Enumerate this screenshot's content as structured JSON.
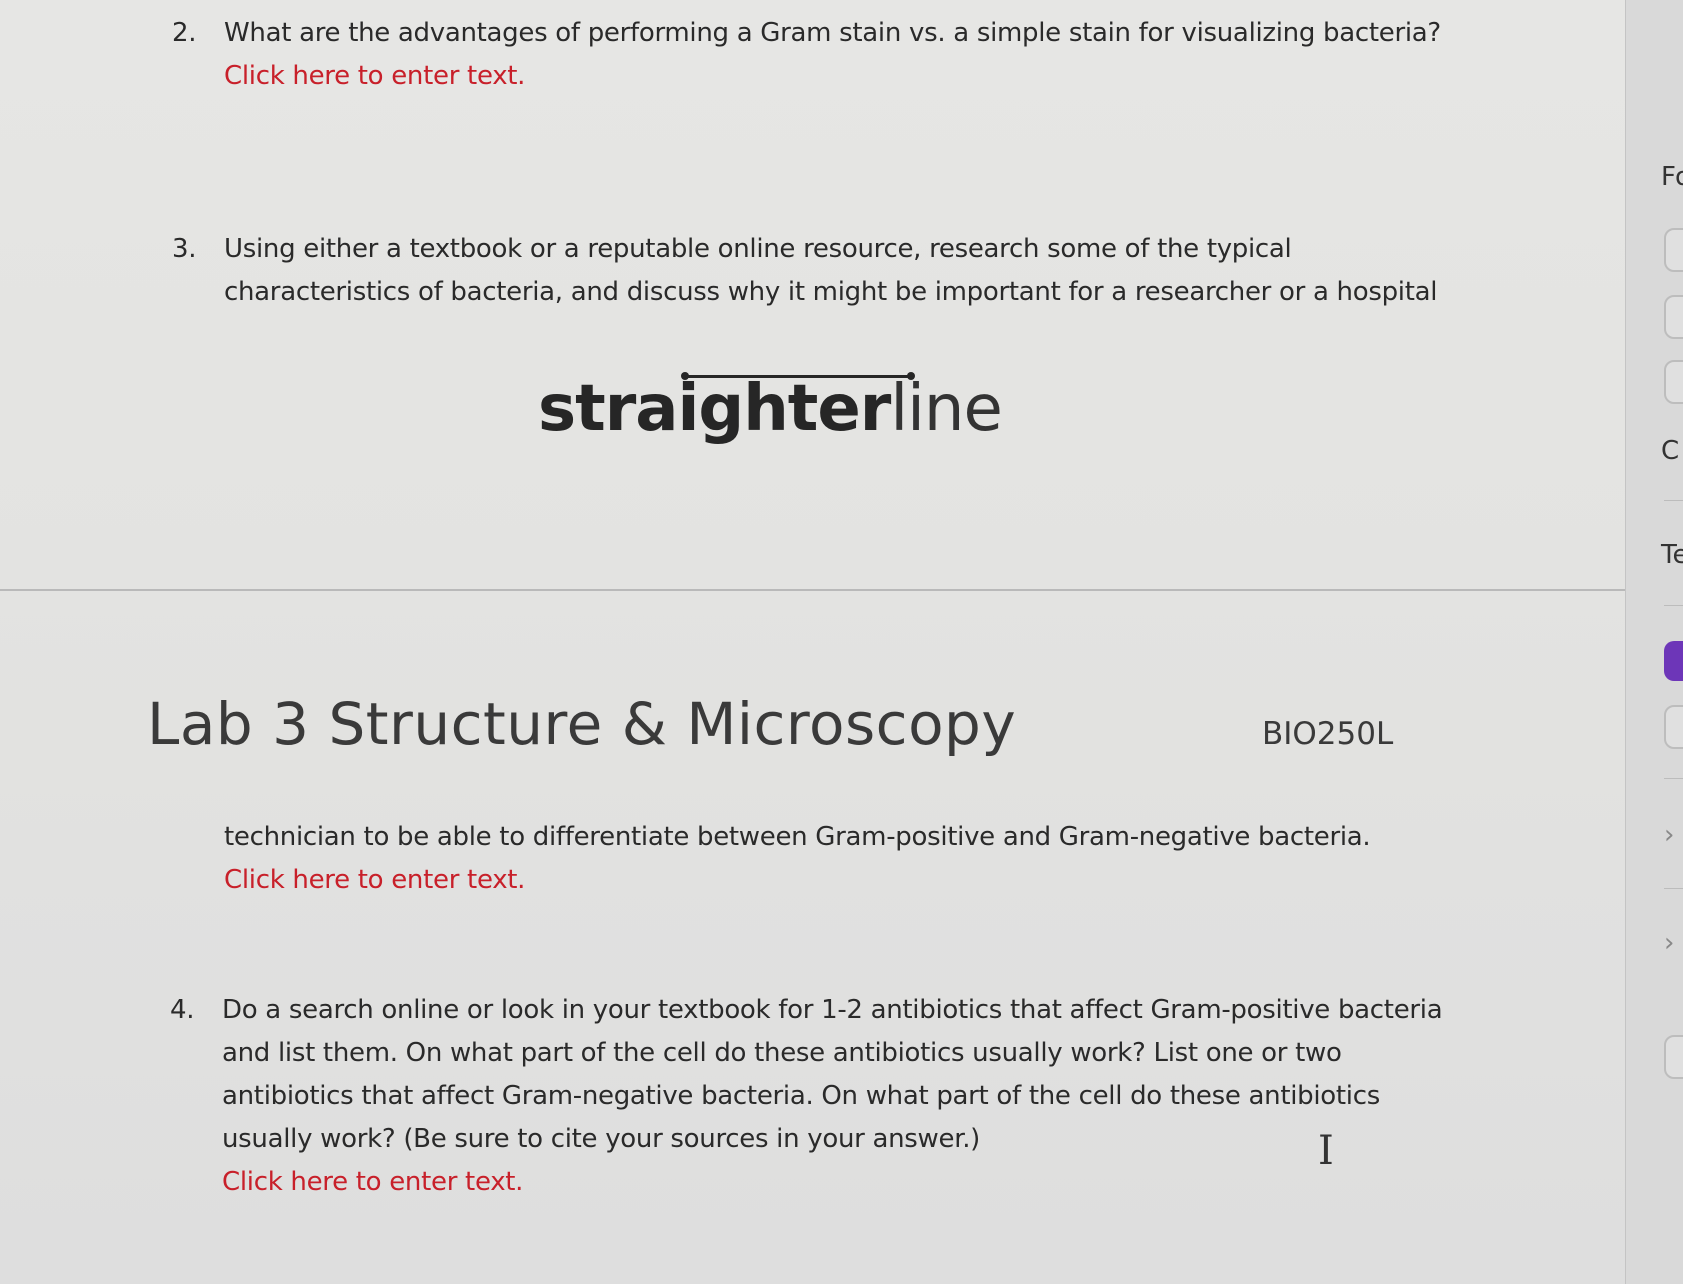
{
  "questions": [
    {
      "number": "2.",
      "text_lines": [
        "What are the advantages of performing a Gram stain vs. a simple stain for visualizing bacteria?"
      ],
      "placeholder": "Click here to enter text."
    },
    {
      "number": "3.",
      "text_lines": [
        "Using either a textbook or a reputable online resource, research some of the typical",
        "characteristics of bacteria, and discuss why it might be important for a researcher or a hospital"
      ]
    },
    {
      "continuation_lines": [
        "technician to be able to differentiate between Gram-positive and Gram-negative bacteria."
      ],
      "placeholder": "Click here to enter text."
    },
    {
      "number": "4.",
      "text_lines": [
        "Do a search online or look in your textbook for 1-2 antibiotics that affect Gram-positive bacteria",
        "and list them. On what part of the cell do these antibiotics usually work? List one or two",
        "antibiotics that affect Gram-negative bacteria. On what part of the cell do these antibiotics",
        "usually work? (Be sure to cite your sources in your answer.)"
      ],
      "placeholder": "Click here to enter text."
    }
  ],
  "logo": {
    "part_bold": "straighter",
    "part_light": "line"
  },
  "page_header": {
    "title": "Lab 3 Structure & Microscopy",
    "course_code": "BIO250L"
  },
  "sidebar": {
    "labels": [
      "Fo",
      "C",
      "Te"
    ],
    "accent_color": "#6d36b8"
  },
  "colors": {
    "placeholder": "#c8202a",
    "text": "#2a2a2a"
  },
  "icons": [
    "text-cursor-icon",
    "chevron-right-icon"
  ]
}
